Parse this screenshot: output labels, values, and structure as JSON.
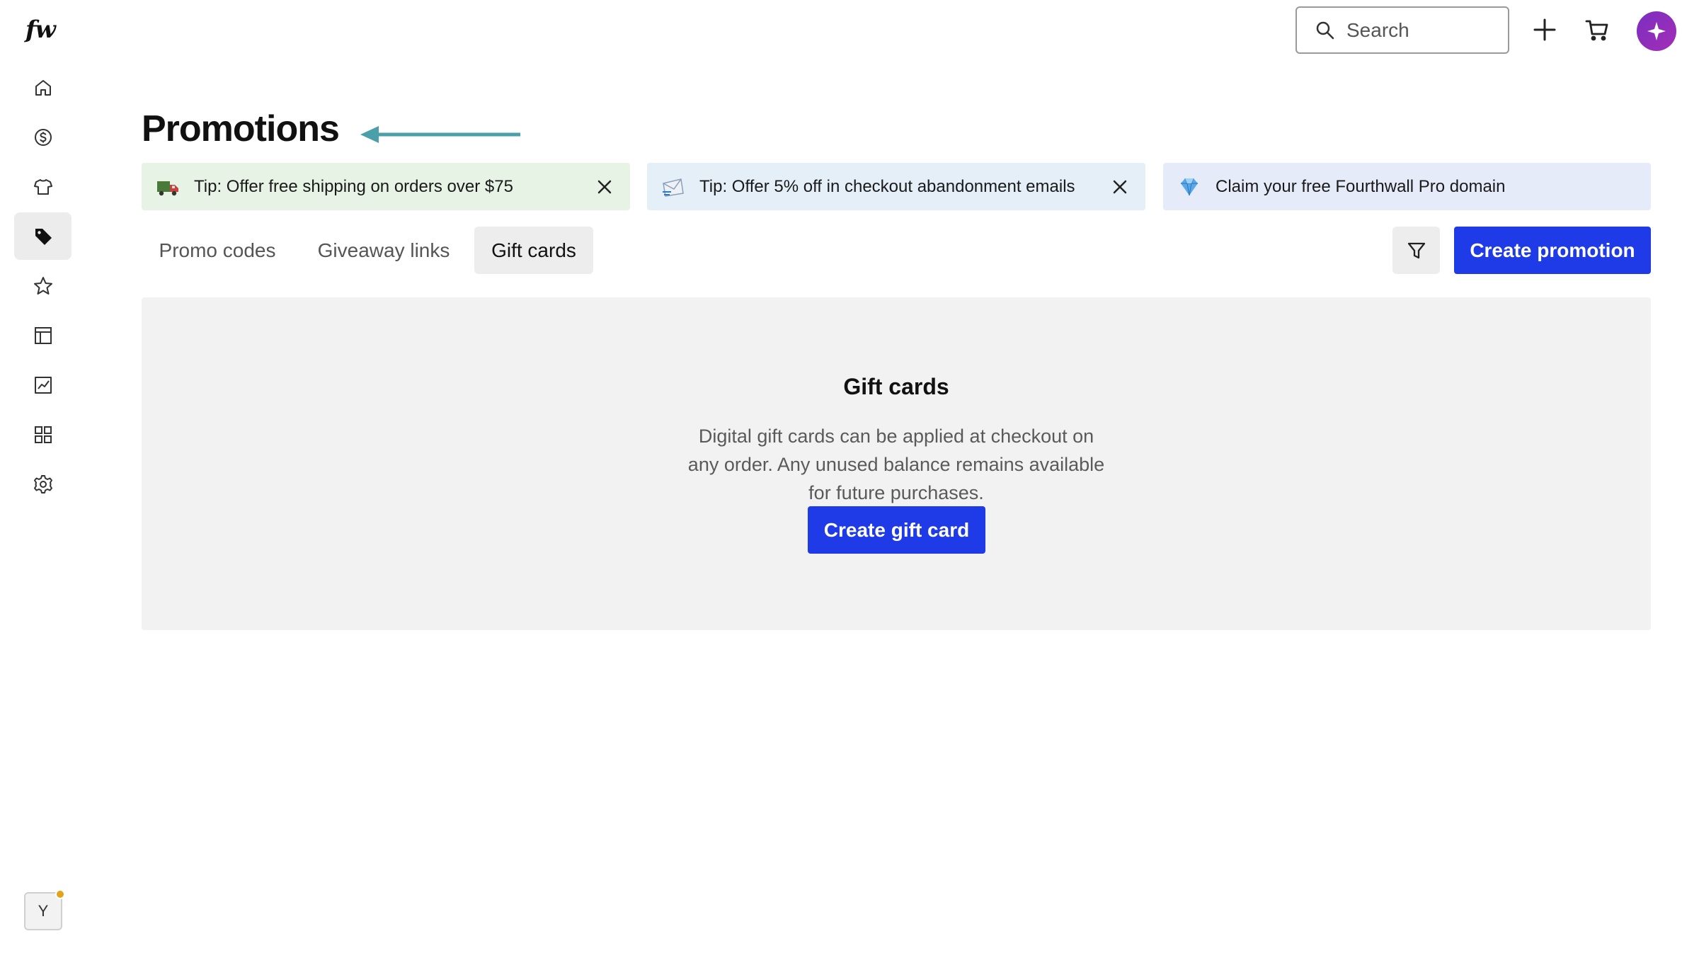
{
  "app": {
    "logo": "fw"
  },
  "sidebar": {
    "items": [
      {
        "name": "home",
        "icon": "home-icon"
      },
      {
        "name": "sales",
        "icon": "dollar-circle-icon"
      },
      {
        "name": "products",
        "icon": "tshirt-icon"
      },
      {
        "name": "promotions",
        "icon": "tag-icon",
        "active": true
      },
      {
        "name": "memberships",
        "icon": "star-icon"
      },
      {
        "name": "site-design",
        "icon": "layout-icon"
      },
      {
        "name": "analytics",
        "icon": "chart-icon"
      },
      {
        "name": "apps",
        "icon": "grid-icon"
      },
      {
        "name": "settings",
        "icon": "gear-icon"
      }
    ],
    "user_initial": "Y"
  },
  "header": {
    "search_placeholder": "Search"
  },
  "page": {
    "title": "Promotions"
  },
  "banners": [
    {
      "icon": "truck-emoji",
      "text": "Tip: Offer free shipping on orders over $75",
      "color": "#e7f3e5"
    },
    {
      "icon": "envelope-emoji",
      "text": "Tip: Offer 5% off in checkout abandonment emails",
      "color": "#e4eff8"
    },
    {
      "icon": "gem-emoji",
      "text": "Claim your free Fourthwall Pro domain",
      "color": "#e6ebfa"
    }
  ],
  "tabs": [
    {
      "label": "Promo codes"
    },
    {
      "label": "Giveaway links"
    },
    {
      "label": "Gift cards",
      "active": true
    }
  ],
  "actions": {
    "create_promotion": "Create promotion"
  },
  "empty_state": {
    "title": "Gift cards",
    "description": "Digital gift cards can be applied at checkout on any order. Any unused balance remains available for future purchases.",
    "button": "Create gift card"
  },
  "colors": {
    "primary": "#1f3be8",
    "annotation_arrow": "#4a9fa8"
  }
}
